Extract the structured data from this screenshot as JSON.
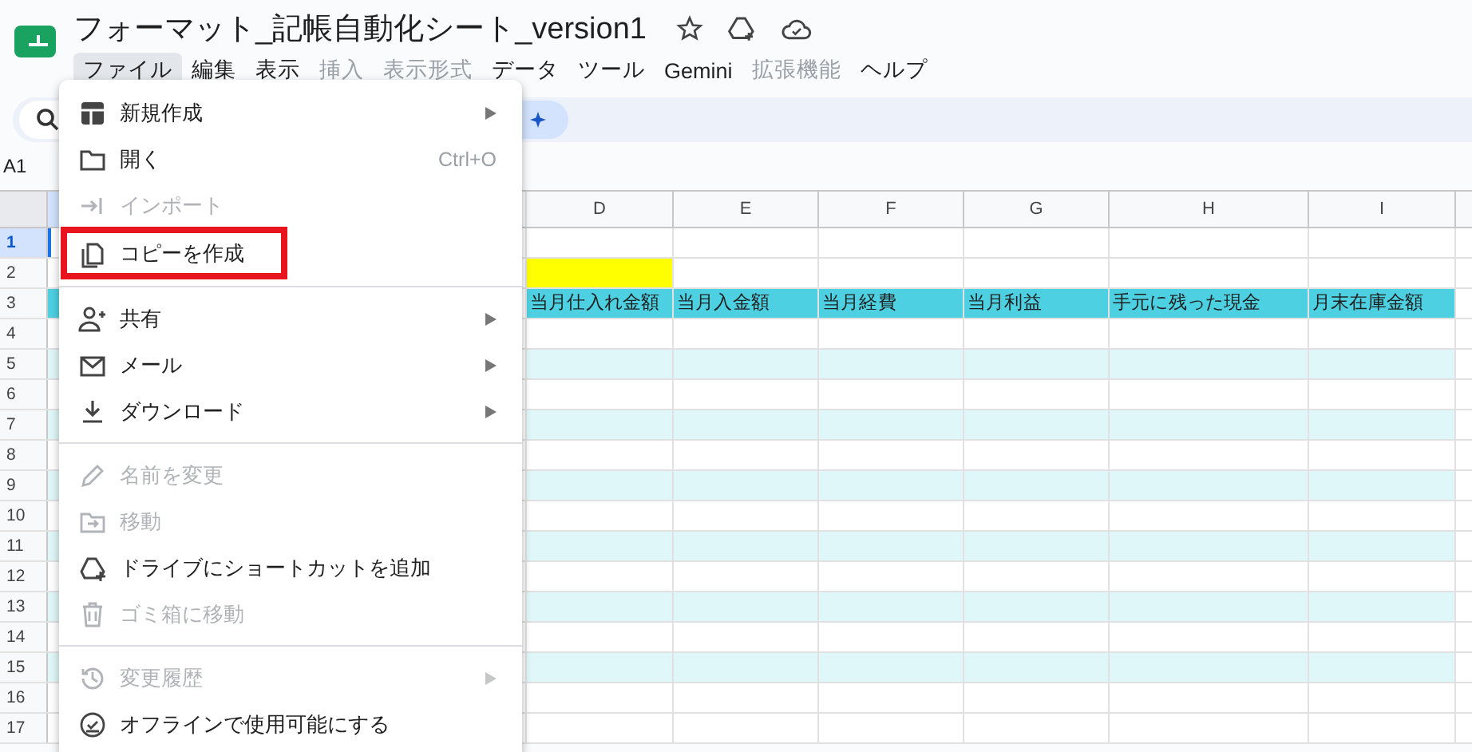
{
  "document": {
    "title": "フォーマット_記帳自動化シート_version1"
  },
  "menu_bar": [
    {
      "label": "ファイル",
      "selected": true,
      "disabled": false
    },
    {
      "label": "編集",
      "selected": false,
      "disabled": false
    },
    {
      "label": "表示",
      "selected": false,
      "disabled": false
    },
    {
      "label": "挿入",
      "selected": false,
      "disabled": true
    },
    {
      "label": "表示形式",
      "selected": false,
      "disabled": true
    },
    {
      "label": "データ",
      "selected": false,
      "disabled": false
    },
    {
      "label": "ツール",
      "selected": false,
      "disabled": false
    },
    {
      "label": "Gemini",
      "selected": false,
      "disabled": false
    },
    {
      "label": "拡張機能",
      "selected": false,
      "disabled": true
    },
    {
      "label": "ヘルプ",
      "selected": false,
      "disabled": false
    }
  ],
  "name_box": "A1",
  "file_menu": [
    {
      "kind": "item",
      "label": "新規作成",
      "disabled": false,
      "submenu": true
    },
    {
      "kind": "item",
      "label": "開く",
      "disabled": false,
      "shortcut": "Ctrl+O"
    },
    {
      "kind": "item",
      "label": "インポート",
      "disabled": true
    },
    {
      "kind": "item",
      "label": "コピーを作成",
      "disabled": false,
      "annotated": true
    },
    {
      "kind": "separator"
    },
    {
      "kind": "item",
      "label": "共有",
      "disabled": false,
      "submenu": true
    },
    {
      "kind": "item",
      "label": "メール",
      "disabled": false,
      "submenu": true
    },
    {
      "kind": "item",
      "label": "ダウンロード",
      "disabled": false,
      "submenu": true
    },
    {
      "kind": "separator"
    },
    {
      "kind": "item",
      "label": "名前を変更",
      "disabled": true
    },
    {
      "kind": "item",
      "label": "移動",
      "disabled": true
    },
    {
      "kind": "item",
      "label": "ドライブにショートカットを追加",
      "disabled": false
    },
    {
      "kind": "item",
      "label": "ゴミ箱に移動",
      "disabled": true
    },
    {
      "kind": "separator"
    },
    {
      "kind": "item",
      "label": "変更履歴",
      "disabled": true,
      "submenu": true
    },
    {
      "kind": "item",
      "label": "オフラインで使用可能にする",
      "disabled": false
    }
  ],
  "sheet": {
    "columns": [
      "D",
      "E",
      "F",
      "G",
      "H",
      "I"
    ],
    "rows": [
      {
        "number": "1",
        "selected": true,
        "kind": "plain"
      },
      {
        "number": "2",
        "selected": false,
        "kind": "marked",
        "color": "#ffff00"
      },
      {
        "number": "3",
        "selected": false,
        "kind": "header",
        "cells": [
          "当月仕入れ金額",
          "当月入金額",
          "当月経費",
          "当月利益",
          "手元に残った現金",
          "月末在庫金額"
        ]
      },
      {
        "number": "4",
        "selected": false,
        "kind": "plain"
      },
      {
        "number": "5",
        "selected": false,
        "kind": "band"
      },
      {
        "number": "6",
        "selected": false,
        "kind": "plain"
      },
      {
        "number": "7",
        "selected": false,
        "kind": "band"
      },
      {
        "number": "8",
        "selected": false,
        "kind": "plain"
      },
      {
        "number": "9",
        "selected": false,
        "kind": "band"
      },
      {
        "number": "10",
        "selected": false,
        "kind": "plain"
      },
      {
        "number": "11",
        "selected": false,
        "kind": "band"
      },
      {
        "number": "12",
        "selected": false,
        "kind": "plain"
      },
      {
        "number": "13",
        "selected": false,
        "kind": "band"
      },
      {
        "number": "14",
        "selected": false,
        "kind": "plain"
      },
      {
        "number": "15",
        "selected": false,
        "kind": "band"
      },
      {
        "number": "16",
        "selected": false,
        "kind": "plain"
      },
      {
        "number": "17",
        "selected": false,
        "kind": "plain"
      }
    ]
  }
}
